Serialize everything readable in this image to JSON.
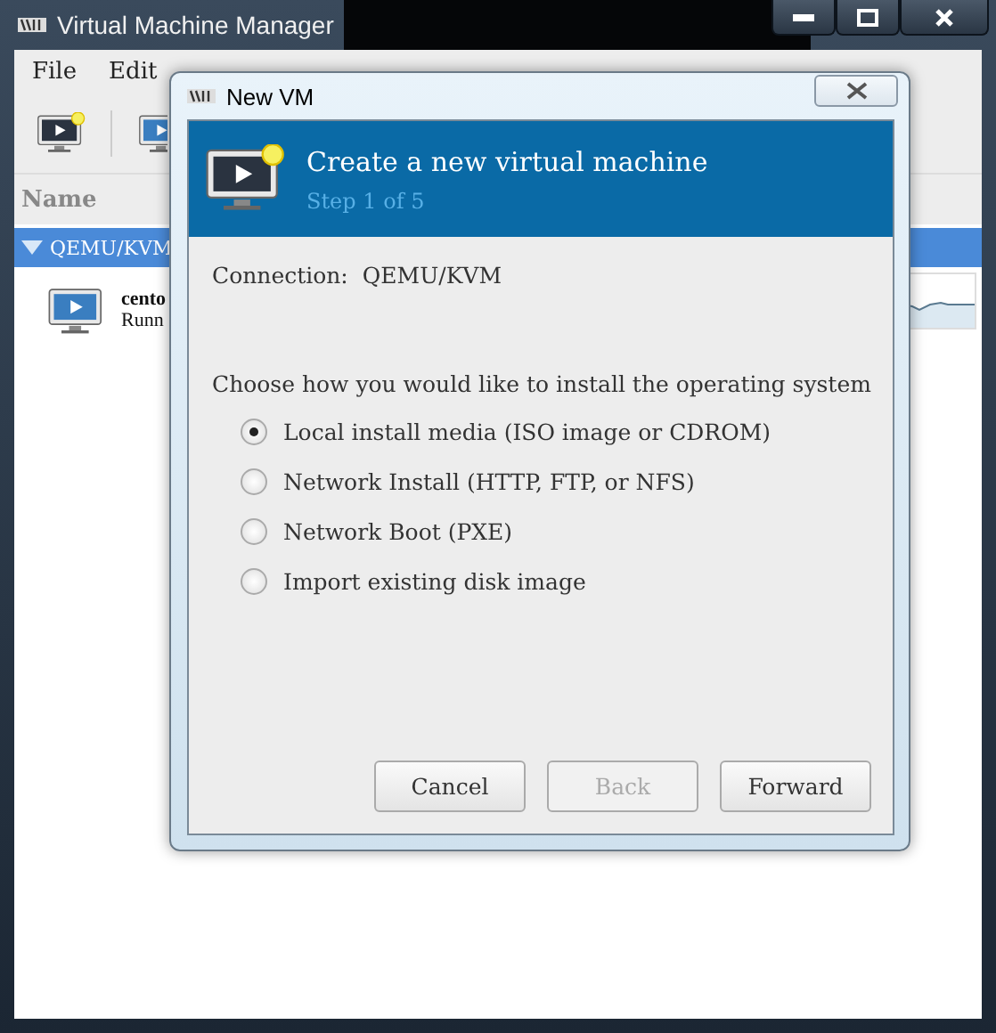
{
  "main_window": {
    "title": "Virtual Machine Manager",
    "menu": [
      "File",
      "Edit"
    ],
    "list_header": "Name",
    "group": {
      "label": "QEMU/KVM",
      "expanded": true,
      "selected": true
    },
    "vm": {
      "name": "cento",
      "status": "Runn"
    }
  },
  "dialog": {
    "title": "New VM",
    "header": {
      "title": "Create a new virtual machine",
      "subtitle": "Step 1 of 5"
    },
    "connection_label": "Connection:",
    "connection_value": "QEMU/KVM",
    "prompt": "Choose how you would like to install the operating system",
    "options": [
      {
        "label": "Local install media (ISO image or CDROM)",
        "selected": true
      },
      {
        "label": "Network Install (HTTP, FTP, or NFS)",
        "selected": false
      },
      {
        "label": "Network Boot (PXE)",
        "selected": false
      },
      {
        "label": "Import existing disk image",
        "selected": false
      }
    ],
    "buttons": [
      {
        "label": "Cancel",
        "disabled": false
      },
      {
        "label": "Back",
        "disabled": true
      },
      {
        "label": "Forward",
        "disabled": false
      }
    ]
  }
}
